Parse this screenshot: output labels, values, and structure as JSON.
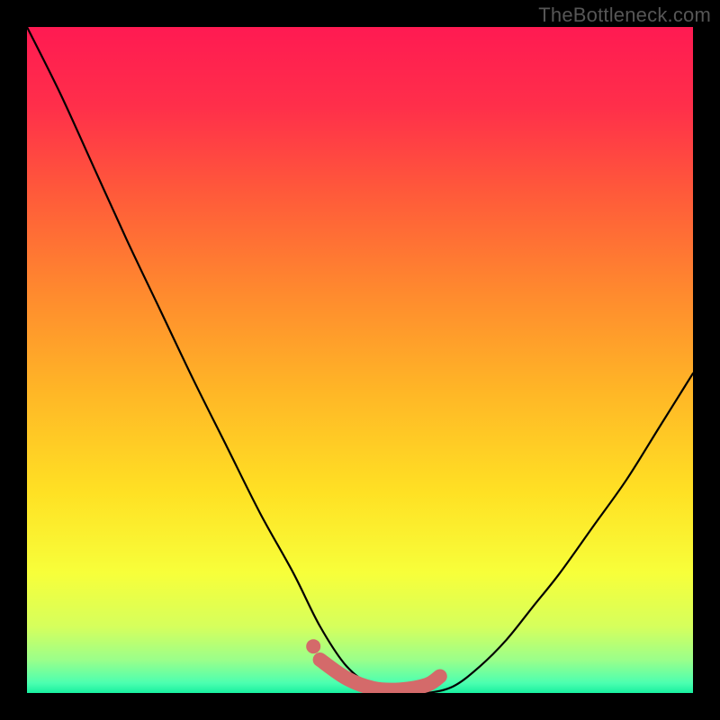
{
  "watermark": "TheBottleneck.com",
  "chart_data": {
    "type": "line",
    "title": "",
    "xlabel": "",
    "ylabel": "",
    "xlim": [
      0,
      100
    ],
    "ylim": [
      0,
      100
    ],
    "grid": false,
    "series": [
      {
        "name": "bottleneck-curve",
        "x": [
          0,
          5,
          10,
          15,
          20,
          25,
          30,
          35,
          40,
          44,
          48,
          52,
          56,
          60,
          64,
          68,
          72,
          76,
          80,
          85,
          90,
          95,
          100
        ],
        "y": [
          100,
          90,
          79,
          68,
          57.5,
          47,
          37,
          27,
          18,
          10,
          4,
          1,
          0,
          0,
          1,
          4,
          8,
          13,
          18,
          25,
          32,
          40,
          48
        ]
      }
    ],
    "highlight_segment": {
      "name": "optimal-zone",
      "x": [
        44,
        48,
        52,
        56,
        60,
        62
      ],
      "y": [
        5,
        2.2,
        0.7,
        0.5,
        1.2,
        2.5
      ]
    },
    "highlight_dot": {
      "name": "marker",
      "x": 43,
      "y": 7
    },
    "background_gradient_stops": [
      {
        "offset": 0.0,
        "color": "#ff1a52"
      },
      {
        "offset": 0.12,
        "color": "#ff2f4a"
      },
      {
        "offset": 0.25,
        "color": "#ff5a3a"
      },
      {
        "offset": 0.4,
        "color": "#ff8a2e"
      },
      {
        "offset": 0.55,
        "color": "#ffb726"
      },
      {
        "offset": 0.7,
        "color": "#ffe124"
      },
      {
        "offset": 0.82,
        "color": "#f7ff3a"
      },
      {
        "offset": 0.9,
        "color": "#d6ff5c"
      },
      {
        "offset": 0.95,
        "color": "#9bff8a"
      },
      {
        "offset": 0.985,
        "color": "#4cffb0"
      },
      {
        "offset": 1.0,
        "color": "#18f0a0"
      }
    ],
    "highlight_color": "#d46a6a",
    "curve_color": "#000000"
  }
}
